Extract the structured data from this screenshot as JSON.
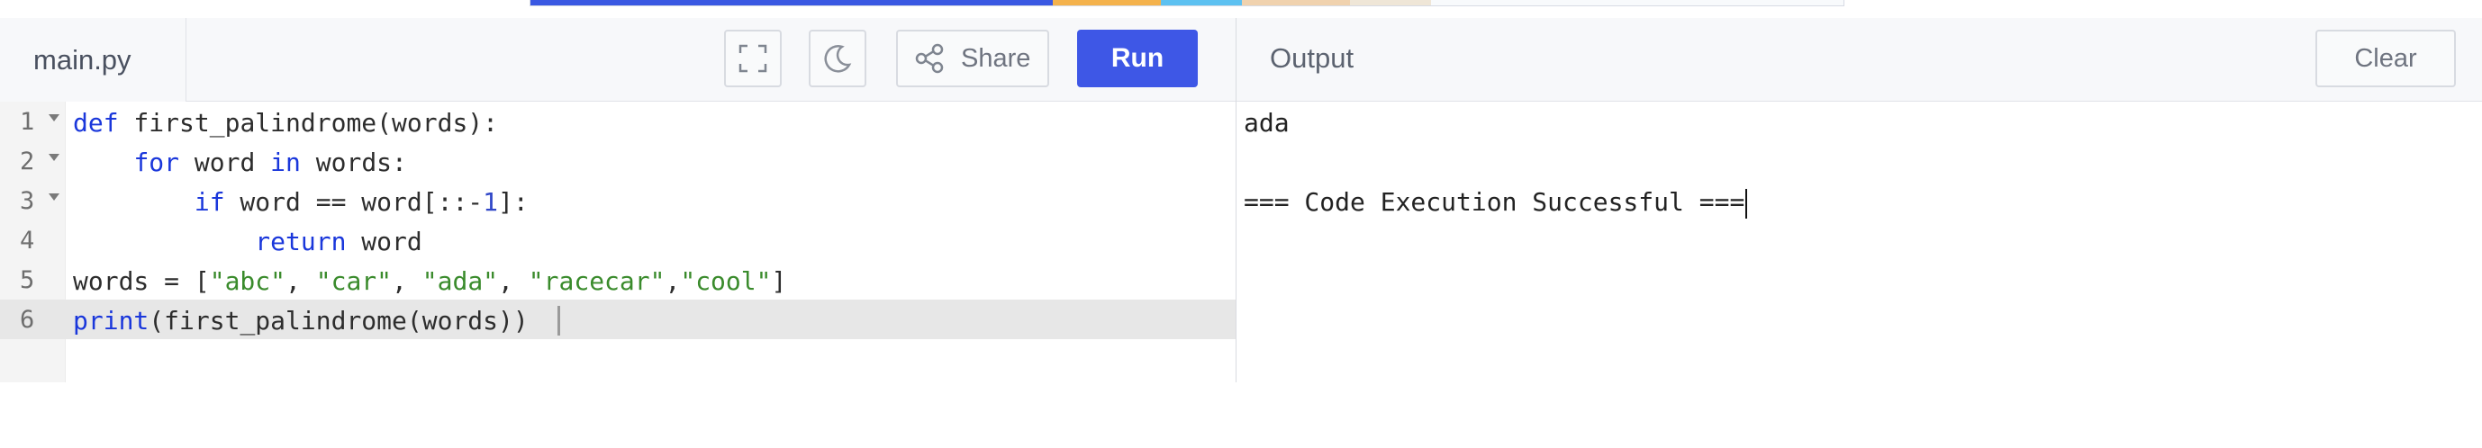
{
  "editor": {
    "file_tab": "main.py",
    "share_label": "Share",
    "run_label": "Run",
    "lines": [
      {
        "n": "1"
      },
      {
        "n": "2"
      },
      {
        "n": "3"
      },
      {
        "n": "4"
      },
      {
        "n": "5"
      },
      {
        "n": "6"
      }
    ]
  },
  "output": {
    "title": "Output",
    "clear_label": "Clear",
    "line1": "ada",
    "line2": "=== Code Execution Successful ==="
  },
  "icons": {
    "fullscreen": "fullscreen-icon",
    "theme": "moon-icon",
    "share": "share-icon"
  },
  "colors": {
    "run_button": "#3e57e6",
    "keyword": "#1a37db",
    "string": "#3a8b2c"
  }
}
